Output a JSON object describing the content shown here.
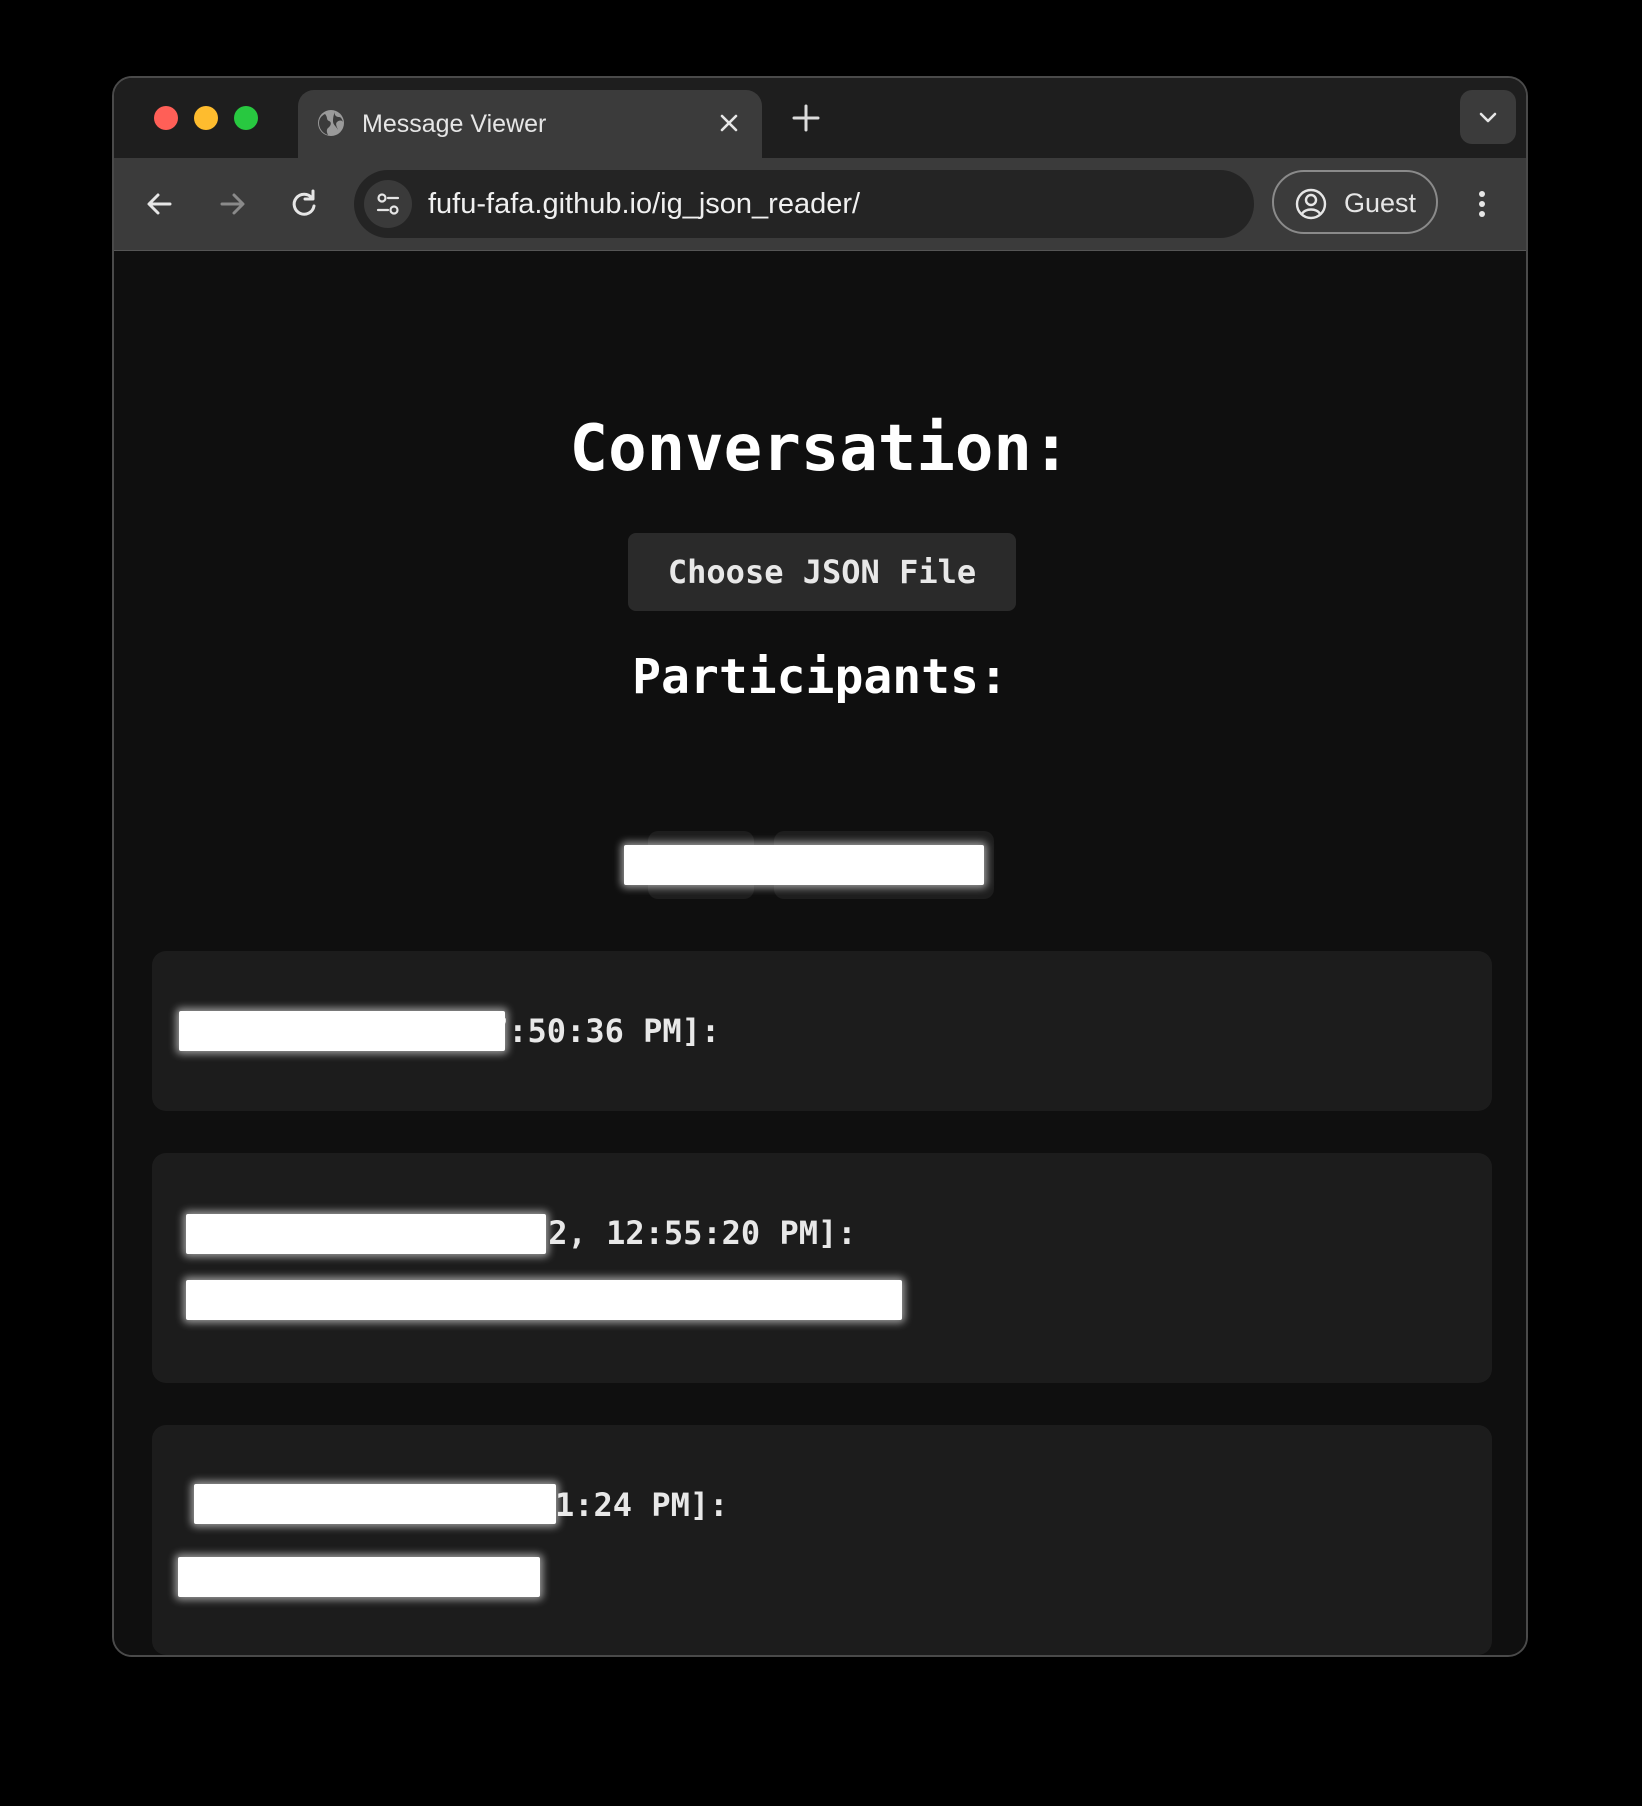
{
  "browser": {
    "tab_title": "Message Viewer",
    "url": "fufu-fafa.github.io/ig_json_reader/",
    "profile_label": "Guest",
    "colors": {
      "traffic_red": "#ff5f57",
      "traffic_yellow": "#febc2e",
      "traffic_green": "#28c840"
    }
  },
  "page": {
    "heading": "Conversation:",
    "file_button_label": "Choose JSON File",
    "participants_heading": "Participants:",
    "messages": [
      {
        "header_visible": "7:50:36 PM]:"
      },
      {
        "header_visible": "22, 12:55:20 PM]:"
      },
      {
        "header_visible": "1:24 PM]:"
      }
    ]
  }
}
